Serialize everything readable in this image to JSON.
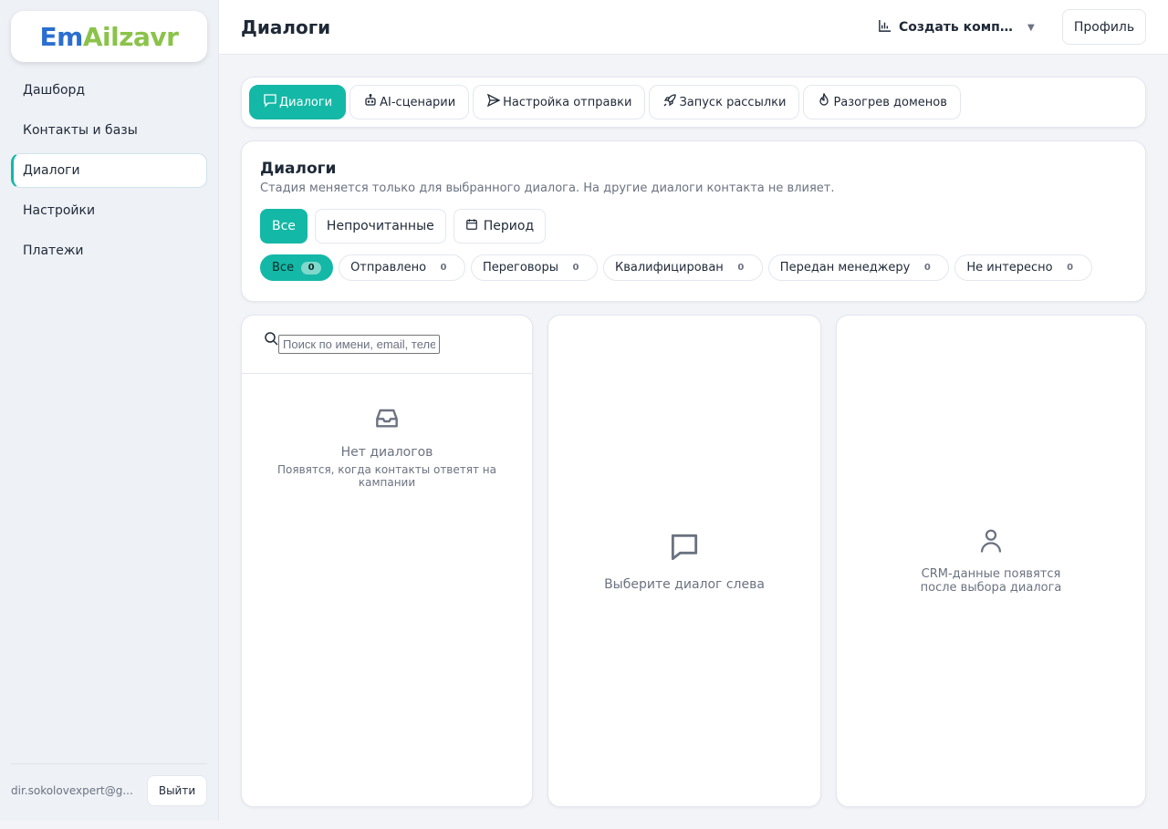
{
  "brand": {
    "part1": "Em",
    "part2": "Ail",
    "part3": "zavr"
  },
  "sidebar": {
    "items": [
      {
        "label": "Дашборд"
      },
      {
        "label": "Контакты и базы"
      },
      {
        "label": "Диалоги",
        "active": true
      },
      {
        "label": "Настройки"
      },
      {
        "label": "Платежи"
      }
    ],
    "user_email": "dir.sokolovexpert@g...",
    "logout_label": "Выйти"
  },
  "header": {
    "title": "Диалоги",
    "campaign_label": "Создать компан...",
    "profile_label": "Профиль"
  },
  "tabs": [
    {
      "label": "Диалоги",
      "icon": "chat-icon",
      "active": true
    },
    {
      "label": "AI-сценарии",
      "icon": "robot-icon"
    },
    {
      "label": "Настройка отправки",
      "icon": "send-icon"
    },
    {
      "label": "Запуск рассылки",
      "icon": "rocket-icon"
    },
    {
      "label": "Разогрев доменов",
      "icon": "flame-icon"
    }
  ],
  "dialogs": {
    "title": "Диалоги",
    "subtitle": "Стадия меняется только для выбранного диалога. На другие диалоги контакта не влияет.",
    "filters": {
      "all": "Все",
      "unread": "Непрочитанные",
      "period": "Период"
    },
    "stages": [
      {
        "label": "Все",
        "count": "0",
        "active": true
      },
      {
        "label": "Отправлено",
        "count": "0"
      },
      {
        "label": "Переговоры",
        "count": "0"
      },
      {
        "label": "Квалифицирован",
        "count": "0"
      },
      {
        "label": "Передан менеджеру",
        "count": "0"
      },
      {
        "label": "Не интересно",
        "count": "0"
      }
    ]
  },
  "list": {
    "search_placeholder": "Поиск по имени, email, телефону",
    "empty_title": "Нет диалогов",
    "empty_subtitle": "Появятся, когда контакты ответят на кампании"
  },
  "chat": {
    "empty": "Выберите диалог слева"
  },
  "crm": {
    "empty": "CRM-данные появятся после выбора диалога"
  },
  "colors": {
    "accent": "#14b8a6",
    "brand_blue": "#2a6fd0",
    "brand_green": "#8bc34a"
  }
}
